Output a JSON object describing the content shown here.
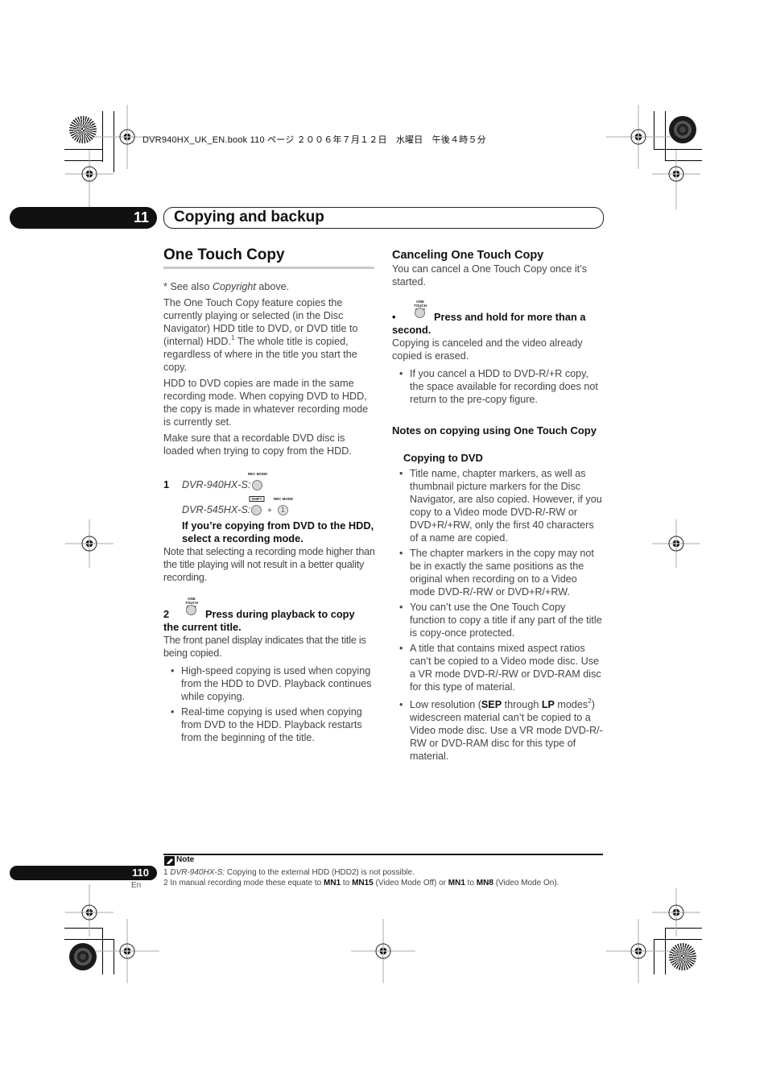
{
  "print_header": "DVR940HX_UK_EN.book  110 ページ  ２００６年７月１２日　水曜日　午後４時５分",
  "chapter": {
    "number": "11",
    "title": "Copying and backup"
  },
  "left_column": {
    "heading": "One Touch Copy",
    "see_also_prefix": "* See also ",
    "see_also_link": "Copyright",
    "see_also_suffix": " above.",
    "para1_a": "The One Touch Copy feature copies the currently playing or selected (in the Disc Navigator) HDD title to DVD, or DVD title to (internal) HDD.",
    "para1_sup": "1",
    "para1_b": " The whole title is copied, regardless of where in the title you start the copy.",
    "para2": "HDD to DVD copies are made in the same recording mode. When copying DVD to HDD, the copy is made in whatever recording mode is currently set.",
    "para3": "Make sure that a recordable DVD disc is loaded when trying to copy from the HDD.",
    "step1": {
      "number": "1",
      "model_a": "DVR-940HX-S:",
      "button_a_label": "REC MODE",
      "model_b": "DVR-545HX-S:",
      "button_shift_label": "SHIFT",
      "plus": "+",
      "button_b_label": "REC MODE",
      "button_b_number": "1",
      "instruction": "If you’re copying from DVD to the HDD, select a recording mode.",
      "note": "Note that selecting a recording mode higher than the title playing will not result in a better quality recording."
    },
    "step2": {
      "number": "2",
      "button_label": "ONE TOUCH COPY",
      "instruction_a": "Press during playback to copy",
      "instruction_b": "the current title.",
      "desc": "The front panel display indicates that the title is being copied.",
      "bullets": [
        "High-speed copying is used when copying from the HDD to DVD. Playback continues while copying.",
        "Real-time copying is used when copying from DVD to the HDD. Playback restarts from the beginning of the title."
      ]
    }
  },
  "right_column": {
    "cancel_heading": "Canceling One Touch Copy",
    "cancel_intro": "You can cancel a One Touch Copy once it’s started.",
    "cancel_button_label": "ONE TOUCH COPY",
    "cancel_instruction_a": "Press and hold for more than a",
    "cancel_instruction_b": "second.",
    "cancel_desc": "Copying is canceled and the video already copied is erased.",
    "cancel_bullets": [
      "If you cancel a HDD to DVD-R/+R copy, the space available for recording does not return to the pre-copy figure."
    ],
    "notes_heading": "Notes on copying using One Touch Copy",
    "dvd_subheading": "Copying to DVD",
    "dvd_bullets": [
      "Title name, chapter markers, as well as thumbnail picture markers for the Disc Navigator, are also copied. However, if you copy to a Video mode DVD-R/-RW or DVD+R/+RW, only the first 40 characters of a name are copied.",
      "The chapter markers in the copy may not be in exactly the same positions as the original when recording on to a Video mode DVD-R/-RW or DVD+R/+RW.",
      "You can’t use the One Touch Copy function to copy a title if any part of the title is copy-once protected.",
      "A title that contains mixed aspect ratios can’t be copied to a Video mode disc. Use a VR mode DVD-R/-RW or DVD-RAM disc for this type of material."
    ],
    "lowres_bullet": {
      "a": "Low resolution (",
      "sep": "SEP",
      "b": " through ",
      "lp": "LP",
      "c": " modes",
      "sup": "2",
      "d": ") widescreen material can’t be copied to a Video mode disc. Use a VR mode DVD-R/-RW or DVD-RAM disc for this type of material."
    }
  },
  "note": {
    "label": "Note",
    "fn1_num": "1 ",
    "fn1_model": "DVR-940HX-S:",
    "fn1_text": " Copying to the external HDD (HDD2) is not possible.",
    "fn2_a": "2 In manual recording mode these equate to ",
    "fn2_mn1": "MN1",
    "fn2_to1": " to ",
    "fn2_mn15": "MN15",
    "fn2_b": " (Video Mode Off) or ",
    "fn2_mn1b": "MN1",
    "fn2_to2": " to ",
    "fn2_mn8": "MN8",
    "fn2_c": " (Video Mode On)."
  },
  "page": {
    "number": "110",
    "lang": "En"
  }
}
